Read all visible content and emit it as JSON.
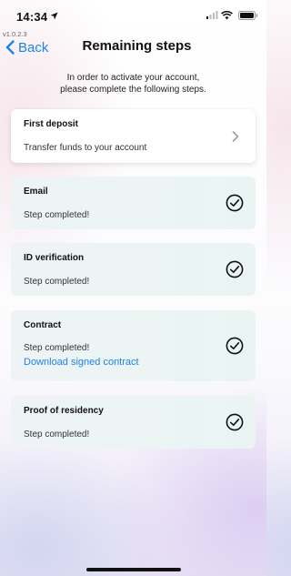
{
  "status_bar": {
    "time": "14:34"
  },
  "version": "v1.0.2.3",
  "nav": {
    "back_label": "Back",
    "title": "Remaining steps"
  },
  "intro": {
    "line1": "In order to activate your account,",
    "line2": "please complete the following steps."
  },
  "steps": [
    {
      "title": "First deposit",
      "subtitle": "Transfer funds to your account",
      "state": "pending",
      "icon": "chevron-right-icon"
    },
    {
      "title": "Email",
      "subtitle": "Step completed!",
      "state": "completed",
      "icon": "check-circle-icon"
    },
    {
      "title": "ID verification",
      "subtitle": "Step completed!",
      "state": "completed",
      "icon": "check-circle-icon"
    },
    {
      "title": "Contract",
      "subtitle": "Step completed!",
      "link": "Download signed contract",
      "state": "completed",
      "icon": "check-circle-icon"
    },
    {
      "title": "Proof of residency",
      "subtitle": "Step completed!",
      "state": "completed",
      "icon": "check-circle-icon"
    }
  ],
  "colors": {
    "accent": "#1a84ea",
    "completed_card": "#eaf3f4",
    "background_tint": "#e9e3f5"
  }
}
